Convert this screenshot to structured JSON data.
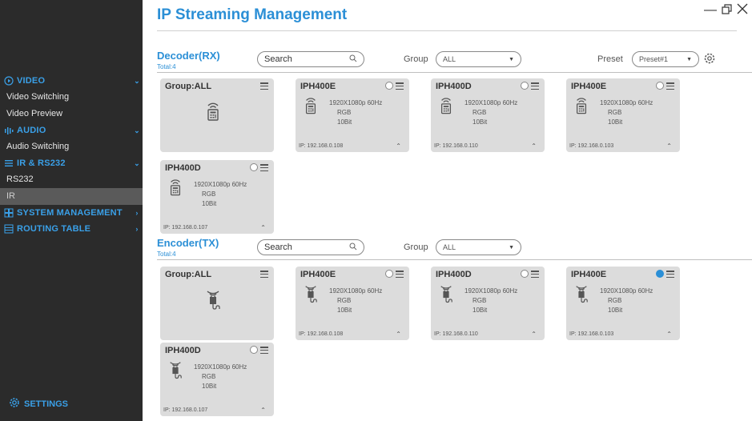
{
  "window": {
    "title": "IP Streaming Management"
  },
  "sidebar": {
    "sections": [
      {
        "label": "VIDEO",
        "icon": "play-circle-icon",
        "items": [
          {
            "label": "Video Switching"
          },
          {
            "label": "Video Preview"
          }
        ]
      },
      {
        "label": "AUDIO",
        "icon": "audio-bars-icon",
        "items": [
          {
            "label": "Audio Switching"
          }
        ]
      },
      {
        "label": "IR & RS232",
        "icon": "list-icon",
        "items": [
          {
            "label": "RS232"
          },
          {
            "label": "IR",
            "active": true
          }
        ]
      },
      {
        "label": "SYSTEM MANAGEMENT",
        "icon": "grid-icon",
        "items": []
      },
      {
        "label": "ROUTING TABLE",
        "icon": "table-icon",
        "items": []
      }
    ],
    "settings_label": "SETTINGS"
  },
  "decoder": {
    "title": "Decoder(RX)",
    "total": "Total:4",
    "search_placeholder": "Search",
    "group_label": "Group",
    "group_value": "ALL",
    "preset_label": "Preset",
    "preset_value": "Preset#1",
    "cards": [
      {
        "name": "Group:ALL",
        "type": "group"
      },
      {
        "name": "IPH400E",
        "spec1": "1920X1080p 60Hz",
        "spec2": "RGB",
        "spec3": "10Bit",
        "ip": "IP: 192.168.0.108",
        "selected": false
      },
      {
        "name": "IPH400D",
        "spec1": "1920X1080p 60Hz",
        "spec2": "RGB",
        "spec3": "10Bit",
        "ip": "IP: 192.168.0.110",
        "selected": false
      },
      {
        "name": "IPH400E",
        "spec1": "1920X1080p 60Hz",
        "spec2": "RGB",
        "spec3": "10Bit",
        "ip": "IP: 192.168.0.103",
        "selected": false
      },
      {
        "name": "IPH400D",
        "spec1": "1920X1080p 60Hz",
        "spec2": "RGB",
        "spec3": "10Bit",
        "ip": "IP: 192.168.0.107",
        "selected": false
      }
    ]
  },
  "encoder": {
    "title": "Encoder(TX)",
    "total": "Total:4",
    "search_placeholder": "Search",
    "group_label": "Group",
    "group_value": "ALL",
    "cards": [
      {
        "name": "Group:ALL",
        "type": "group"
      },
      {
        "name": "IPH400E",
        "spec1": "1920X1080p 60Hz",
        "spec2": "RGB",
        "spec3": "10Bit",
        "ip": "IP: 192.168.0.108",
        "selected": false
      },
      {
        "name": "IPH400D",
        "spec1": "1920X1080p 60Hz",
        "spec2": "RGB",
        "spec3": "10Bit",
        "ip": "IP: 192.168.0.110",
        "selected": false
      },
      {
        "name": "IPH400E",
        "spec1": "1920X1080p 60Hz",
        "spec2": "RGB",
        "spec3": "10Bit",
        "ip": "IP: 192.168.0.103",
        "selected": true
      },
      {
        "name": "IPH400D",
        "spec1": "1920X1080p 60Hz",
        "spec2": "RGB",
        "spec3": "10Bit",
        "ip": "IP: 192.168.0.107",
        "selected": false
      }
    ]
  },
  "colors": {
    "accent": "#2b8fd6",
    "sidebar_bg": "#2b2b2b",
    "card_bg": "#dcdcdc",
    "active_item_bg": "#5a5a5a"
  }
}
